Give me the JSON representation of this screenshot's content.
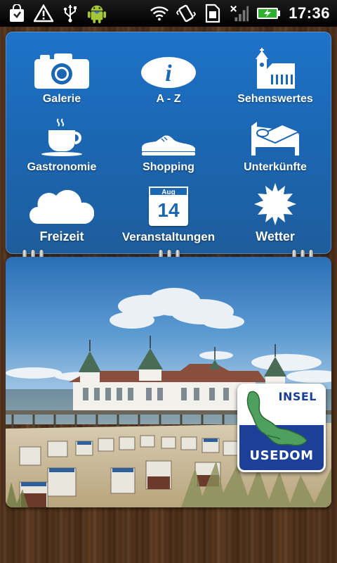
{
  "status_bar": {
    "time": "17:36",
    "icons": [
      "shopping-bag-icon",
      "warning-icon",
      "usb-icon",
      "android-robot-icon",
      "wifi-icon",
      "vibrate-icon",
      "sim-card-icon",
      "no-signal-icon",
      "battery-charging-icon"
    ]
  },
  "menu": {
    "items": [
      {
        "label": "Galerie",
        "icon": "camera-icon"
      },
      {
        "label": "A - Z",
        "icon": "info-icon"
      },
      {
        "label": "Sehenswertes",
        "icon": "church-icon"
      },
      {
        "label": "Gastronomie",
        "icon": "coffee-cup-icon"
      },
      {
        "label": "Shopping",
        "icon": "shoe-icon"
      },
      {
        "label": "Unterkünfte",
        "icon": "bed-icon"
      },
      {
        "label": "Freizeit",
        "icon": "cloud-icon"
      },
      {
        "label": "Veranstaltungen",
        "icon": "calendar-icon"
      },
      {
        "label": "Wetter",
        "icon": "sun-icon"
      }
    ],
    "calendar": {
      "month": "Aug",
      "day": "14"
    }
  },
  "badge": {
    "line1": "INSEL",
    "line2": "USEDOM"
  }
}
